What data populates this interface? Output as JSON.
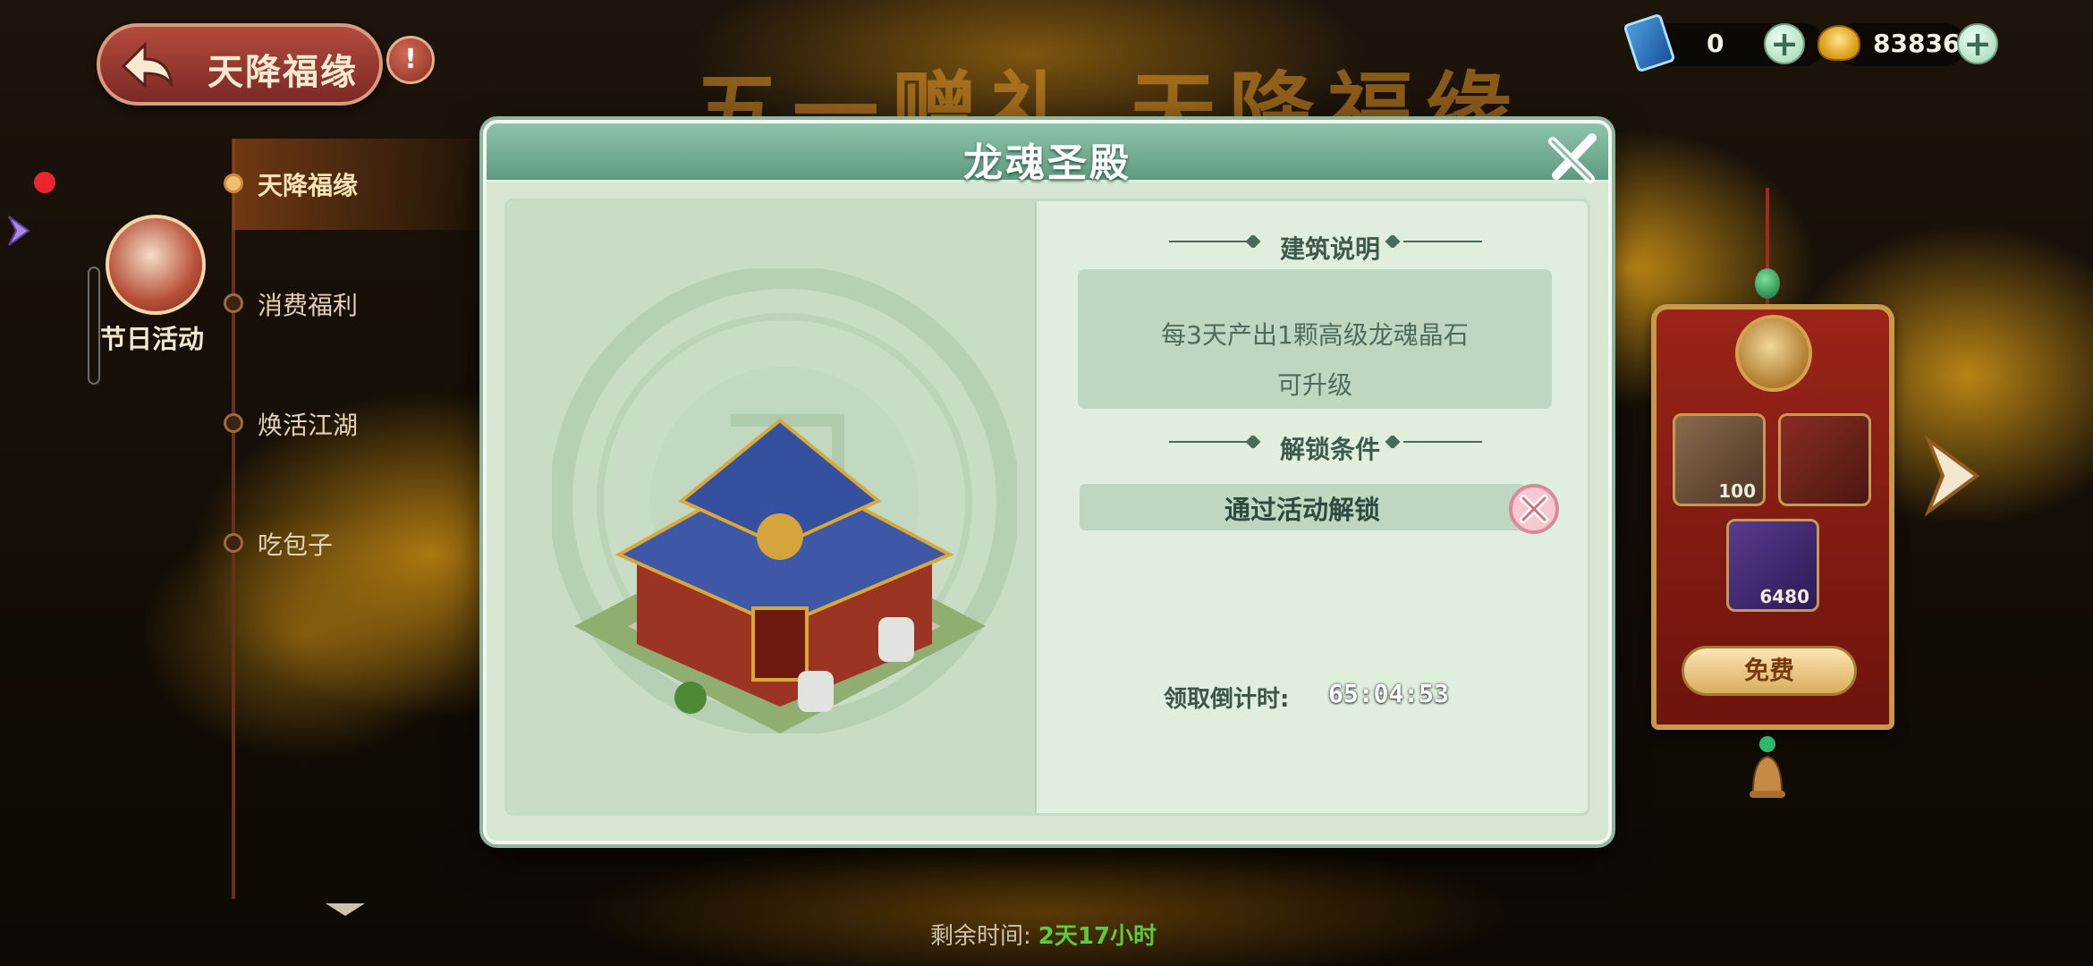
{
  "background": {
    "title": "五一赠礼 天降福缘"
  },
  "header": {
    "title": "天降福缘",
    "info_icon": "exclamation-icon",
    "back_icon": "back-arrow-icon"
  },
  "currency": [
    {
      "name": "ticket",
      "value": "0",
      "icon": "ticket-icon"
    },
    {
      "name": "gold-ingot",
      "value": "83836",
      "icon": "gold-ingot-icon"
    }
  ],
  "side_menu": {
    "category_label": "节日活动",
    "items": [
      {
        "label": "天降福缘",
        "active": true
      },
      {
        "label": "消费福利",
        "active": false
      },
      {
        "label": "焕活江湖",
        "active": false
      },
      {
        "label": "吃包子",
        "active": false
      }
    ]
  },
  "footer": {
    "remaining_label": "剩余时间:",
    "remaining_value": "2天17小时"
  },
  "reward_panel": {
    "slots": [
      {
        "icon": "ornament-icon",
        "count": "100"
      },
      {
        "icon": "pavilion-icon",
        "count": ""
      },
      {
        "icon": "gold-ingot-icon",
        "count": "6480"
      }
    ],
    "button_label": "免费"
  },
  "modal": {
    "title": "龙魂圣殿",
    "building_section_title": "建筑说明",
    "description_lines": [
      "每3天产出1颗高级龙魂晶石",
      "可升级"
    ],
    "unlock_section_title": "解锁条件",
    "unlock_condition": "通过活动解锁",
    "countdown_label": "领取倒计时:",
    "countdown_value": "65:04:53"
  },
  "colors": {
    "accent_green": "#5f9a80",
    "remain_green": "#5ecb3d",
    "menu_red": "#9a2418"
  }
}
